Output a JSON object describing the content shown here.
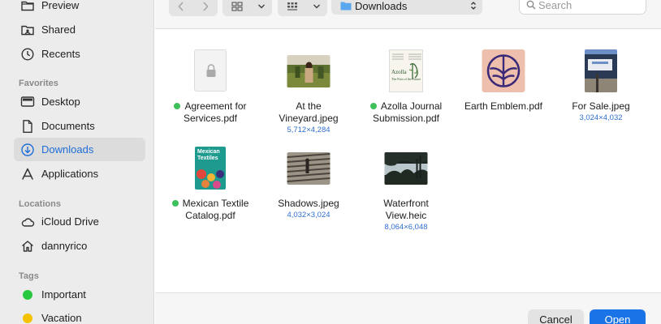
{
  "sidebar": {
    "items_top": [
      {
        "label": "Preview",
        "icon": "folder-icon"
      },
      {
        "label": "Shared",
        "icon": "shared-folder-icon"
      },
      {
        "label": "Recents",
        "icon": "clock-icon"
      }
    ],
    "favorites_header": "Favorites",
    "favorites": [
      {
        "label": "Desktop",
        "icon": "desktop-icon"
      },
      {
        "label": "Documents",
        "icon": "document-icon"
      },
      {
        "label": "Downloads",
        "icon": "download-icon",
        "selected": true
      },
      {
        "label": "Applications",
        "icon": "applications-icon"
      }
    ],
    "locations_header": "Locations",
    "locations": [
      {
        "label": "iCloud Drive",
        "icon": "cloud-icon"
      },
      {
        "label": "dannyrico",
        "icon": "home-icon"
      }
    ],
    "tags_header": "Tags",
    "tags": [
      {
        "label": "Important",
        "color": "#28c840"
      },
      {
        "label": "Vacation",
        "color": "#f5c200"
      }
    ]
  },
  "toolbar": {
    "location": "Downloads",
    "search_placeholder": "Search"
  },
  "files": [
    {
      "line1": "Agreement for",
      "line2": "Services.pdf",
      "dims": "",
      "tagged": true
    },
    {
      "line1": "At the",
      "line2": "Vineyard.jpeg",
      "dims": "5,712×4,284",
      "tagged": false
    },
    {
      "line1": "Azolla Journal",
      "line2": "Submission.pdf",
      "dims": "",
      "tagged": true
    },
    {
      "line1": "Earth Emblem.pdf",
      "line2": "",
      "dims": "",
      "tagged": false
    },
    {
      "line1": "For Sale.jpeg",
      "line2": "",
      "dims": "3,024×4,032",
      "tagged": false
    },
    {
      "line1": "Mexican Textile",
      "line2": "Catalog.pdf",
      "dims": "",
      "tagged": true
    },
    {
      "line1": "Shadows.jpeg",
      "line2": "",
      "dims": "4,032×3,024",
      "tagged": false
    },
    {
      "line1": "Waterfront",
      "line2": "View.heic",
      "dims": "8,064×6,048",
      "tagged": false
    }
  ],
  "thumb_text": {
    "journal_title": "Azolla",
    "journal_subtitle": "The Fern of the Future",
    "catalog_title": "Mexican Textiles"
  },
  "colors": {
    "accent": "#1a74e8",
    "tag_green": "#3ec15a"
  },
  "footer": {
    "cancel_label": "Cancel",
    "open_label": "Open"
  }
}
